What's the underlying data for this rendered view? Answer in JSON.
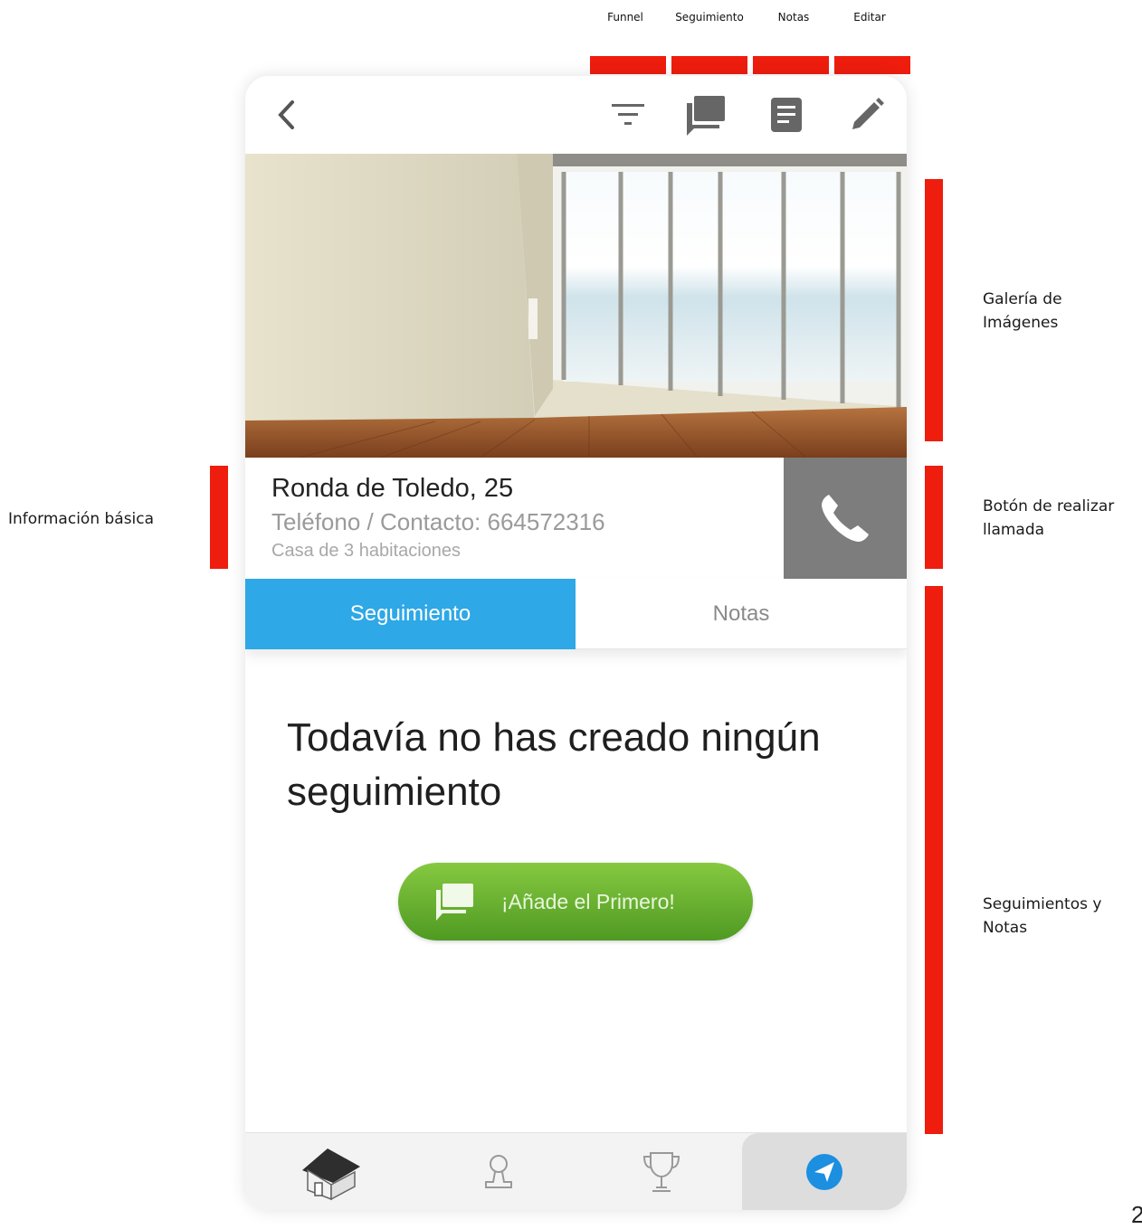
{
  "annotations": {
    "top": {
      "funnel": "Funnel",
      "seguimiento": "Seguimiento",
      "notas": "Notas",
      "editar": "Editar"
    },
    "gallery": [
      "Galería de",
      "Imágenes"
    ],
    "basic_info": "Información básica",
    "call_button": [
      "Botón de realizar",
      "llamada"
    ],
    "follow_notes": [
      "Seguimientos y",
      "Notas"
    ],
    "page_number": "2",
    "bar_color": "#ee1d0e"
  },
  "navbar": {
    "icons": [
      "back-icon",
      "filter-icon",
      "chat-icon",
      "notes-icon",
      "edit-icon"
    ]
  },
  "listing": {
    "address": "Ronda de Toledo, 25",
    "phone": "Teléfono / Contacto: 664572316",
    "description": "Casa de 3 habitaciones"
  },
  "tabs": {
    "active": "Seguimiento",
    "inactive": "Notas",
    "active_color": "#2ea8e6"
  },
  "empty_state": {
    "message": "Todavía no has creado ningún seguimiento",
    "button_label": "¡Añade el Primero!"
  },
  "bottom_bar": {
    "items": [
      "house-icon",
      "user-icon",
      "trophy-icon",
      "navigation-icon"
    ],
    "active_index": 3
  }
}
